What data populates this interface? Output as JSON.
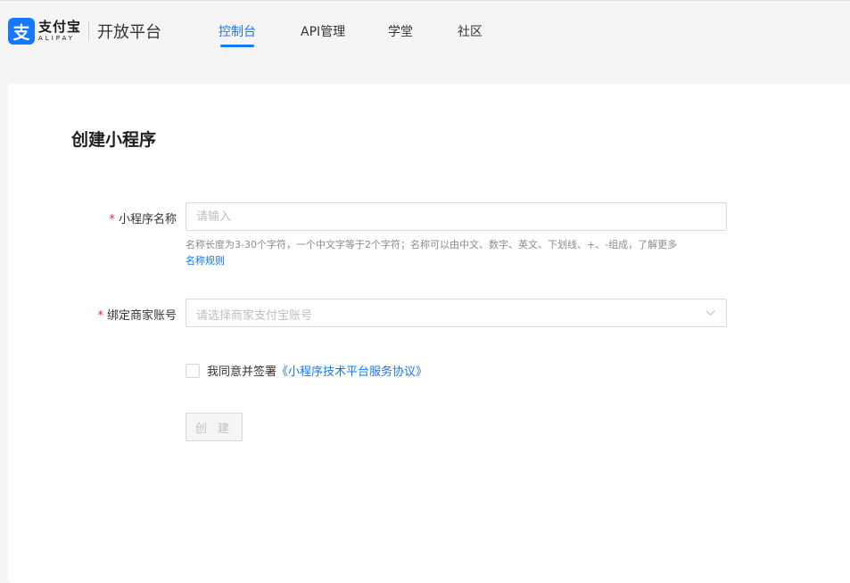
{
  "header": {
    "logo": {
      "mark": "支",
      "name_cn": "支付宝",
      "name_en": "ALIPAY",
      "platform": "开放平台"
    },
    "nav": [
      {
        "label": "控制台",
        "active": true
      },
      {
        "label": "API管理",
        "active": false
      },
      {
        "label": "学堂",
        "active": false
      },
      {
        "label": "社区",
        "active": false
      }
    ],
    "accent_color": "#1677ff"
  },
  "form": {
    "title": "创建小程序",
    "name_field": {
      "required_mark": "*",
      "label": "小程序名称",
      "value": "",
      "placeholder": "请输入",
      "hint_text": "名称长度为3-30个字符，一个中文字等于2个字符；名称可以由中文、数字、英文、下划线、+、-组成，了解更多",
      "hint_link": "名称规则"
    },
    "account_field": {
      "required_mark": "*",
      "label": "绑定商家账号",
      "placeholder": "请选择商家支付宝账号",
      "icon": "chevron-down-icon"
    },
    "agreement": {
      "checked": false,
      "text": "我同意并签署",
      "link": "《小程序技术平台服务协议》"
    },
    "submit": {
      "label": "创 建",
      "disabled": true
    }
  }
}
